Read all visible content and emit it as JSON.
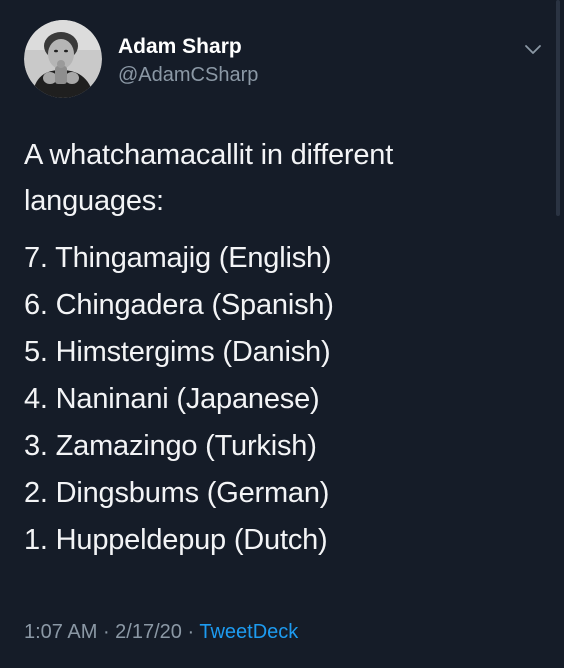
{
  "author": {
    "display_name": "Adam Sharp",
    "handle": "@AdamCSharp",
    "avatar_icon": "profile-photo"
  },
  "menu": {
    "icon": "chevron-down-icon"
  },
  "tweet": {
    "intro_lines": [
      "A whatchamacallit in different",
      "languages:"
    ],
    "list": [
      "7. Thingamajig (English)",
      "6. Chingadera (Spanish)",
      "5. Himstergims (Danish)",
      "4. Naninani (Japanese)",
      "3. Zamazingo (Turkish)",
      "2. Dingsbums (German)",
      "1. Huppeldepup (Dutch)"
    ],
    "time": "1:07 AM",
    "date": "2/17/20",
    "separator": " · ",
    "source": "TweetDeck"
  },
  "colors": {
    "background": "#151c28",
    "text": "#f3f4f6",
    "secondary": "#8b98a5",
    "link": "#1d9bf0"
  }
}
